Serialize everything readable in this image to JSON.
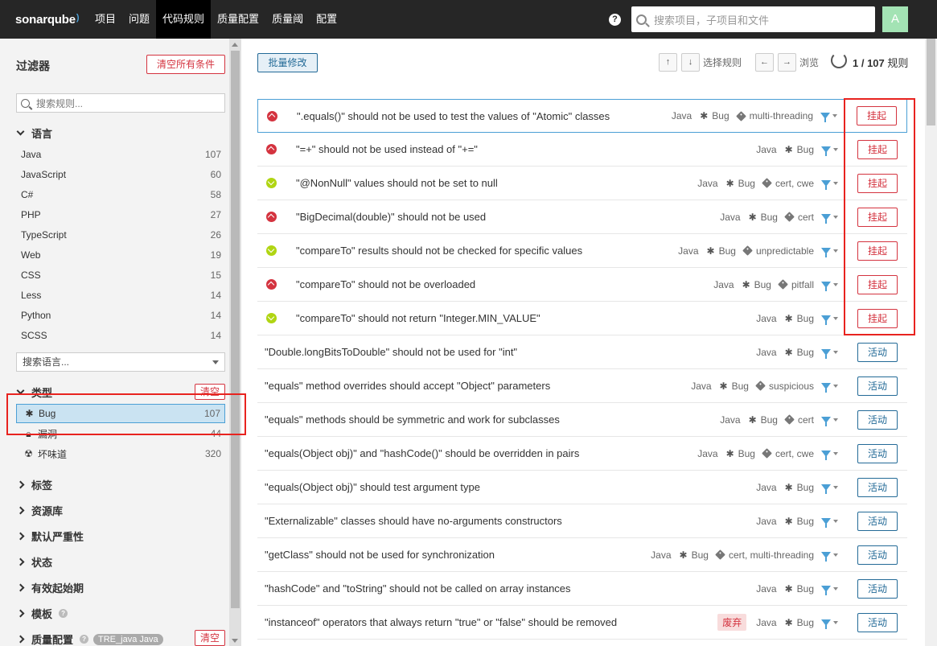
{
  "navbar": {
    "logo": "sonarqube",
    "items": [
      "项目",
      "问题",
      "代码规则",
      "质量配置",
      "质量阈",
      "配置"
    ],
    "active_index": 2,
    "help": "?",
    "search_placeholder": "搜索项目，子项目和文件",
    "avatar": "A"
  },
  "sidebar": {
    "title": "过滤器",
    "clear_all": "清空所有条件",
    "search_placeholder": "搜索规则...",
    "language_facet": "语言",
    "languages": [
      {
        "name": "Java",
        "count": "107"
      },
      {
        "name": "JavaScript",
        "count": "60"
      },
      {
        "name": "C#",
        "count": "58"
      },
      {
        "name": "PHP",
        "count": "27"
      },
      {
        "name": "TypeScript",
        "count": "26"
      },
      {
        "name": "Web",
        "count": "19"
      },
      {
        "name": "CSS",
        "count": "15"
      },
      {
        "name": "Less",
        "count": "14"
      },
      {
        "name": "Python",
        "count": "14"
      },
      {
        "name": "SCSS",
        "count": "14"
      }
    ],
    "language_search_placeholder": "搜索语言...",
    "type_facet": "类型",
    "type_clear": "清空",
    "types": [
      {
        "name": "Bug",
        "count": "107",
        "icon": "bug-icon",
        "selected": true
      },
      {
        "name": "漏洞",
        "count": "44",
        "icon": "lock-icon",
        "selected": false
      },
      {
        "name": "坏味道",
        "count": "320",
        "icon": "radiation-icon",
        "selected": false
      }
    ],
    "collapsed_facets": [
      "标签",
      "资源库",
      "默认严重性",
      "状态",
      "有效起始期",
      "模板"
    ],
    "quality_profile_facet": "质量配置",
    "quality_profile_badge": "TRE_java Java",
    "quality_profile_clear": "清空"
  },
  "toolbar": {
    "bulk_change": "批量修改",
    "up_arrow": "↑",
    "down_arrow": "↓",
    "select_rule": "选择规则",
    "left_arrow": "←",
    "right_arrow": "→",
    "browse": "浏览",
    "counter": "1 / 107",
    "counter_suffix": "规则"
  },
  "rules": [
    {
      "title": "\".equals()\" should not be used to test the values of \"Atomic\" classes",
      "lang": "Java",
      "type": "Bug",
      "tags": "multi-threading",
      "severity": "up",
      "action": "挂起",
      "action_style": "red"
    },
    {
      "title": "\"=+\" should not be used instead of \"+=\"",
      "lang": "Java",
      "type": "Bug",
      "tags": "",
      "severity": "up",
      "action": "挂起",
      "action_style": "red"
    },
    {
      "title": "\"@NonNull\" values should not be set to null",
      "lang": "Java",
      "type": "Bug",
      "tags": "cert, cwe",
      "severity": "down",
      "action": "挂起",
      "action_style": "red"
    },
    {
      "title": "\"BigDecimal(double)\" should not be used",
      "lang": "Java",
      "type": "Bug",
      "tags": "cert",
      "severity": "up",
      "action": "挂起",
      "action_style": "red"
    },
    {
      "title": "\"compareTo\" results should not be checked for specific values",
      "lang": "Java",
      "type": "Bug",
      "tags": "unpredictable",
      "severity": "down",
      "action": "挂起",
      "action_style": "red"
    },
    {
      "title": "\"compareTo\" should not be overloaded",
      "lang": "Java",
      "type": "Bug",
      "tags": "pitfall",
      "severity": "up",
      "action": "挂起",
      "action_style": "red"
    },
    {
      "title": "\"compareTo\" should not return \"Integer.MIN_VALUE\"",
      "lang": "Java",
      "type": "Bug",
      "tags": "",
      "severity": "down",
      "action": "挂起",
      "action_style": "red"
    },
    {
      "title": "\"Double.longBitsToDouble\" should not be used for \"int\"",
      "lang": "Java",
      "type": "Bug",
      "tags": "",
      "severity": "",
      "action": "活动",
      "action_style": "blue"
    },
    {
      "title": "\"equals\" method overrides should accept \"Object\" parameters",
      "lang": "Java",
      "type": "Bug",
      "tags": "suspicious",
      "severity": "",
      "action": "活动",
      "action_style": "blue"
    },
    {
      "title": "\"equals\" methods should be symmetric and work for subclasses",
      "lang": "Java",
      "type": "Bug",
      "tags": "cert",
      "severity": "",
      "action": "活动",
      "action_style": "blue"
    },
    {
      "title": "\"equals(Object obj)\" and \"hashCode()\" should be overridden in pairs",
      "lang": "Java",
      "type": "Bug",
      "tags": "cert, cwe",
      "severity": "",
      "action": "活动",
      "action_style": "blue"
    },
    {
      "title": "\"equals(Object obj)\" should test argument type",
      "lang": "Java",
      "type": "Bug",
      "tags": "",
      "severity": "",
      "action": "活动",
      "action_style": "blue"
    },
    {
      "title": "\"Externalizable\" classes should have no-arguments constructors",
      "lang": "Java",
      "type": "Bug",
      "tags": "",
      "severity": "",
      "action": "活动",
      "action_style": "blue"
    },
    {
      "title": "\"getClass\" should not be used for synchronization",
      "lang": "Java",
      "type": "Bug",
      "tags": "cert, multi-threading",
      "severity": "",
      "action": "活动",
      "action_style": "blue"
    },
    {
      "title": "\"hashCode\" and \"toString\" should not be called on array instances",
      "lang": "Java",
      "type": "Bug",
      "tags": "",
      "severity": "",
      "action": "活动",
      "action_style": "blue"
    },
    {
      "title": "\"instanceof\" operators that always return \"true\" or \"false\" should be removed",
      "lang": "Java",
      "type": "Bug",
      "tags": "",
      "severity": "",
      "deprecated": "废弃",
      "action": "活动",
      "action_style": "blue"
    }
  ]
}
